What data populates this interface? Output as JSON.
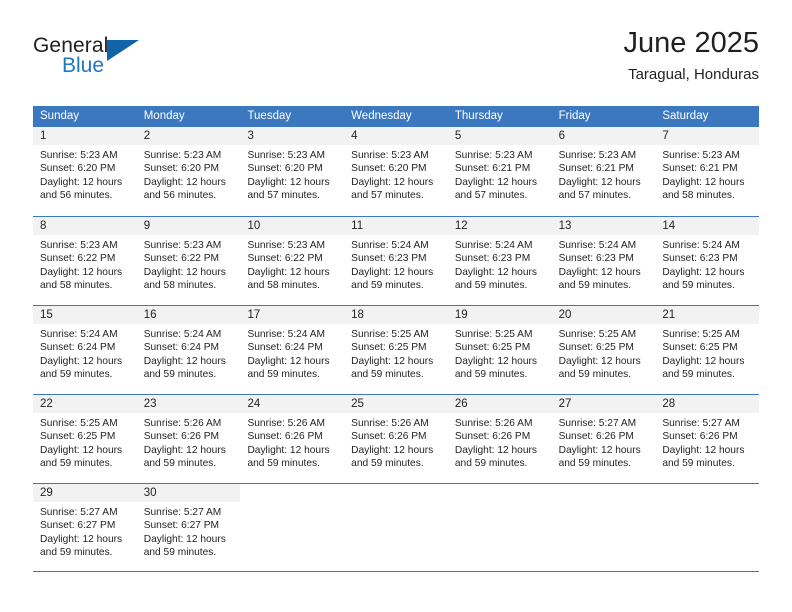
{
  "logo": {
    "word1": "General",
    "word2": "Blue",
    "triangle_color": "#1263a8",
    "blue_color": "#2077c1"
  },
  "header": {
    "title": "June 2025",
    "subtitle": "Taragual, Honduras"
  },
  "theme": {
    "header_blue": "#3b78c0",
    "daynum_band": "#f2f2f2",
    "text": "#231f20"
  },
  "calendar": {
    "weekdays": [
      "Sunday",
      "Monday",
      "Tuesday",
      "Wednesday",
      "Thursday",
      "Friday",
      "Saturday"
    ],
    "weeks": [
      [
        {
          "day": "1",
          "sunrise": "Sunrise: 5:23 AM",
          "sunset": "Sunset: 6:20 PM",
          "daylight_line1": "Daylight: 12 hours",
          "daylight_line2": "and 56 minutes."
        },
        {
          "day": "2",
          "sunrise": "Sunrise: 5:23 AM",
          "sunset": "Sunset: 6:20 PM",
          "daylight_line1": "Daylight: 12 hours",
          "daylight_line2": "and 56 minutes."
        },
        {
          "day": "3",
          "sunrise": "Sunrise: 5:23 AM",
          "sunset": "Sunset: 6:20 PM",
          "daylight_line1": "Daylight: 12 hours",
          "daylight_line2": "and 57 minutes."
        },
        {
          "day": "4",
          "sunrise": "Sunrise: 5:23 AM",
          "sunset": "Sunset: 6:20 PM",
          "daylight_line1": "Daylight: 12 hours",
          "daylight_line2": "and 57 minutes."
        },
        {
          "day": "5",
          "sunrise": "Sunrise: 5:23 AM",
          "sunset": "Sunset: 6:21 PM",
          "daylight_line1": "Daylight: 12 hours",
          "daylight_line2": "and 57 minutes."
        },
        {
          "day": "6",
          "sunrise": "Sunrise: 5:23 AM",
          "sunset": "Sunset: 6:21 PM",
          "daylight_line1": "Daylight: 12 hours",
          "daylight_line2": "and 57 minutes."
        },
        {
          "day": "7",
          "sunrise": "Sunrise: 5:23 AM",
          "sunset": "Sunset: 6:21 PM",
          "daylight_line1": "Daylight: 12 hours",
          "daylight_line2": "and 58 minutes."
        }
      ],
      [
        {
          "day": "8",
          "sunrise": "Sunrise: 5:23 AM",
          "sunset": "Sunset: 6:22 PM",
          "daylight_line1": "Daylight: 12 hours",
          "daylight_line2": "and 58 minutes."
        },
        {
          "day": "9",
          "sunrise": "Sunrise: 5:23 AM",
          "sunset": "Sunset: 6:22 PM",
          "daylight_line1": "Daylight: 12 hours",
          "daylight_line2": "and 58 minutes."
        },
        {
          "day": "10",
          "sunrise": "Sunrise: 5:23 AM",
          "sunset": "Sunset: 6:22 PM",
          "daylight_line1": "Daylight: 12 hours",
          "daylight_line2": "and 58 minutes."
        },
        {
          "day": "11",
          "sunrise": "Sunrise: 5:24 AM",
          "sunset": "Sunset: 6:23 PM",
          "daylight_line1": "Daylight: 12 hours",
          "daylight_line2": "and 59 minutes."
        },
        {
          "day": "12",
          "sunrise": "Sunrise: 5:24 AM",
          "sunset": "Sunset: 6:23 PM",
          "daylight_line1": "Daylight: 12 hours",
          "daylight_line2": "and 59 minutes."
        },
        {
          "day": "13",
          "sunrise": "Sunrise: 5:24 AM",
          "sunset": "Sunset: 6:23 PM",
          "daylight_line1": "Daylight: 12 hours",
          "daylight_line2": "and 59 minutes."
        },
        {
          "day": "14",
          "sunrise": "Sunrise: 5:24 AM",
          "sunset": "Sunset: 6:23 PM",
          "daylight_line1": "Daylight: 12 hours",
          "daylight_line2": "and 59 minutes."
        }
      ],
      [
        {
          "day": "15",
          "sunrise": "Sunrise: 5:24 AM",
          "sunset": "Sunset: 6:24 PM",
          "daylight_line1": "Daylight: 12 hours",
          "daylight_line2": "and 59 minutes."
        },
        {
          "day": "16",
          "sunrise": "Sunrise: 5:24 AM",
          "sunset": "Sunset: 6:24 PM",
          "daylight_line1": "Daylight: 12 hours",
          "daylight_line2": "and 59 minutes."
        },
        {
          "day": "17",
          "sunrise": "Sunrise: 5:24 AM",
          "sunset": "Sunset: 6:24 PM",
          "daylight_line1": "Daylight: 12 hours",
          "daylight_line2": "and 59 minutes."
        },
        {
          "day": "18",
          "sunrise": "Sunrise: 5:25 AM",
          "sunset": "Sunset: 6:25 PM",
          "daylight_line1": "Daylight: 12 hours",
          "daylight_line2": "and 59 minutes."
        },
        {
          "day": "19",
          "sunrise": "Sunrise: 5:25 AM",
          "sunset": "Sunset: 6:25 PM",
          "daylight_line1": "Daylight: 12 hours",
          "daylight_line2": "and 59 minutes."
        },
        {
          "day": "20",
          "sunrise": "Sunrise: 5:25 AM",
          "sunset": "Sunset: 6:25 PM",
          "daylight_line1": "Daylight: 12 hours",
          "daylight_line2": "and 59 minutes."
        },
        {
          "day": "21",
          "sunrise": "Sunrise: 5:25 AM",
          "sunset": "Sunset: 6:25 PM",
          "daylight_line1": "Daylight: 12 hours",
          "daylight_line2": "and 59 minutes."
        }
      ],
      [
        {
          "day": "22",
          "sunrise": "Sunrise: 5:25 AM",
          "sunset": "Sunset: 6:25 PM",
          "daylight_line1": "Daylight: 12 hours",
          "daylight_line2": "and 59 minutes."
        },
        {
          "day": "23",
          "sunrise": "Sunrise: 5:26 AM",
          "sunset": "Sunset: 6:26 PM",
          "daylight_line1": "Daylight: 12 hours",
          "daylight_line2": "and 59 minutes."
        },
        {
          "day": "24",
          "sunrise": "Sunrise: 5:26 AM",
          "sunset": "Sunset: 6:26 PM",
          "daylight_line1": "Daylight: 12 hours",
          "daylight_line2": "and 59 minutes."
        },
        {
          "day": "25",
          "sunrise": "Sunrise: 5:26 AM",
          "sunset": "Sunset: 6:26 PM",
          "daylight_line1": "Daylight: 12 hours",
          "daylight_line2": "and 59 minutes."
        },
        {
          "day": "26",
          "sunrise": "Sunrise: 5:26 AM",
          "sunset": "Sunset: 6:26 PM",
          "daylight_line1": "Daylight: 12 hours",
          "daylight_line2": "and 59 minutes."
        },
        {
          "day": "27",
          "sunrise": "Sunrise: 5:27 AM",
          "sunset": "Sunset: 6:26 PM",
          "daylight_line1": "Daylight: 12 hours",
          "daylight_line2": "and 59 minutes."
        },
        {
          "day": "28",
          "sunrise": "Sunrise: 5:27 AM",
          "sunset": "Sunset: 6:26 PM",
          "daylight_line1": "Daylight: 12 hours",
          "daylight_line2": "and 59 minutes."
        }
      ],
      [
        {
          "day": "29",
          "sunrise": "Sunrise: 5:27 AM",
          "sunset": "Sunset: 6:27 PM",
          "daylight_line1": "Daylight: 12 hours",
          "daylight_line2": "and 59 minutes."
        },
        {
          "day": "30",
          "sunrise": "Sunrise: 5:27 AM",
          "sunset": "Sunset: 6:27 PM",
          "daylight_line1": "Daylight: 12 hours",
          "daylight_line2": "and 59 minutes."
        },
        {
          "day": "",
          "sunrise": "",
          "sunset": "",
          "daylight_line1": "",
          "daylight_line2": ""
        },
        {
          "day": "",
          "sunrise": "",
          "sunset": "",
          "daylight_line1": "",
          "daylight_line2": ""
        },
        {
          "day": "",
          "sunrise": "",
          "sunset": "",
          "daylight_line1": "",
          "daylight_line2": ""
        },
        {
          "day": "",
          "sunrise": "",
          "sunset": "",
          "daylight_line1": "",
          "daylight_line2": ""
        },
        {
          "day": "",
          "sunrise": "",
          "sunset": "",
          "daylight_line1": "",
          "daylight_line2": ""
        }
      ]
    ]
  }
}
